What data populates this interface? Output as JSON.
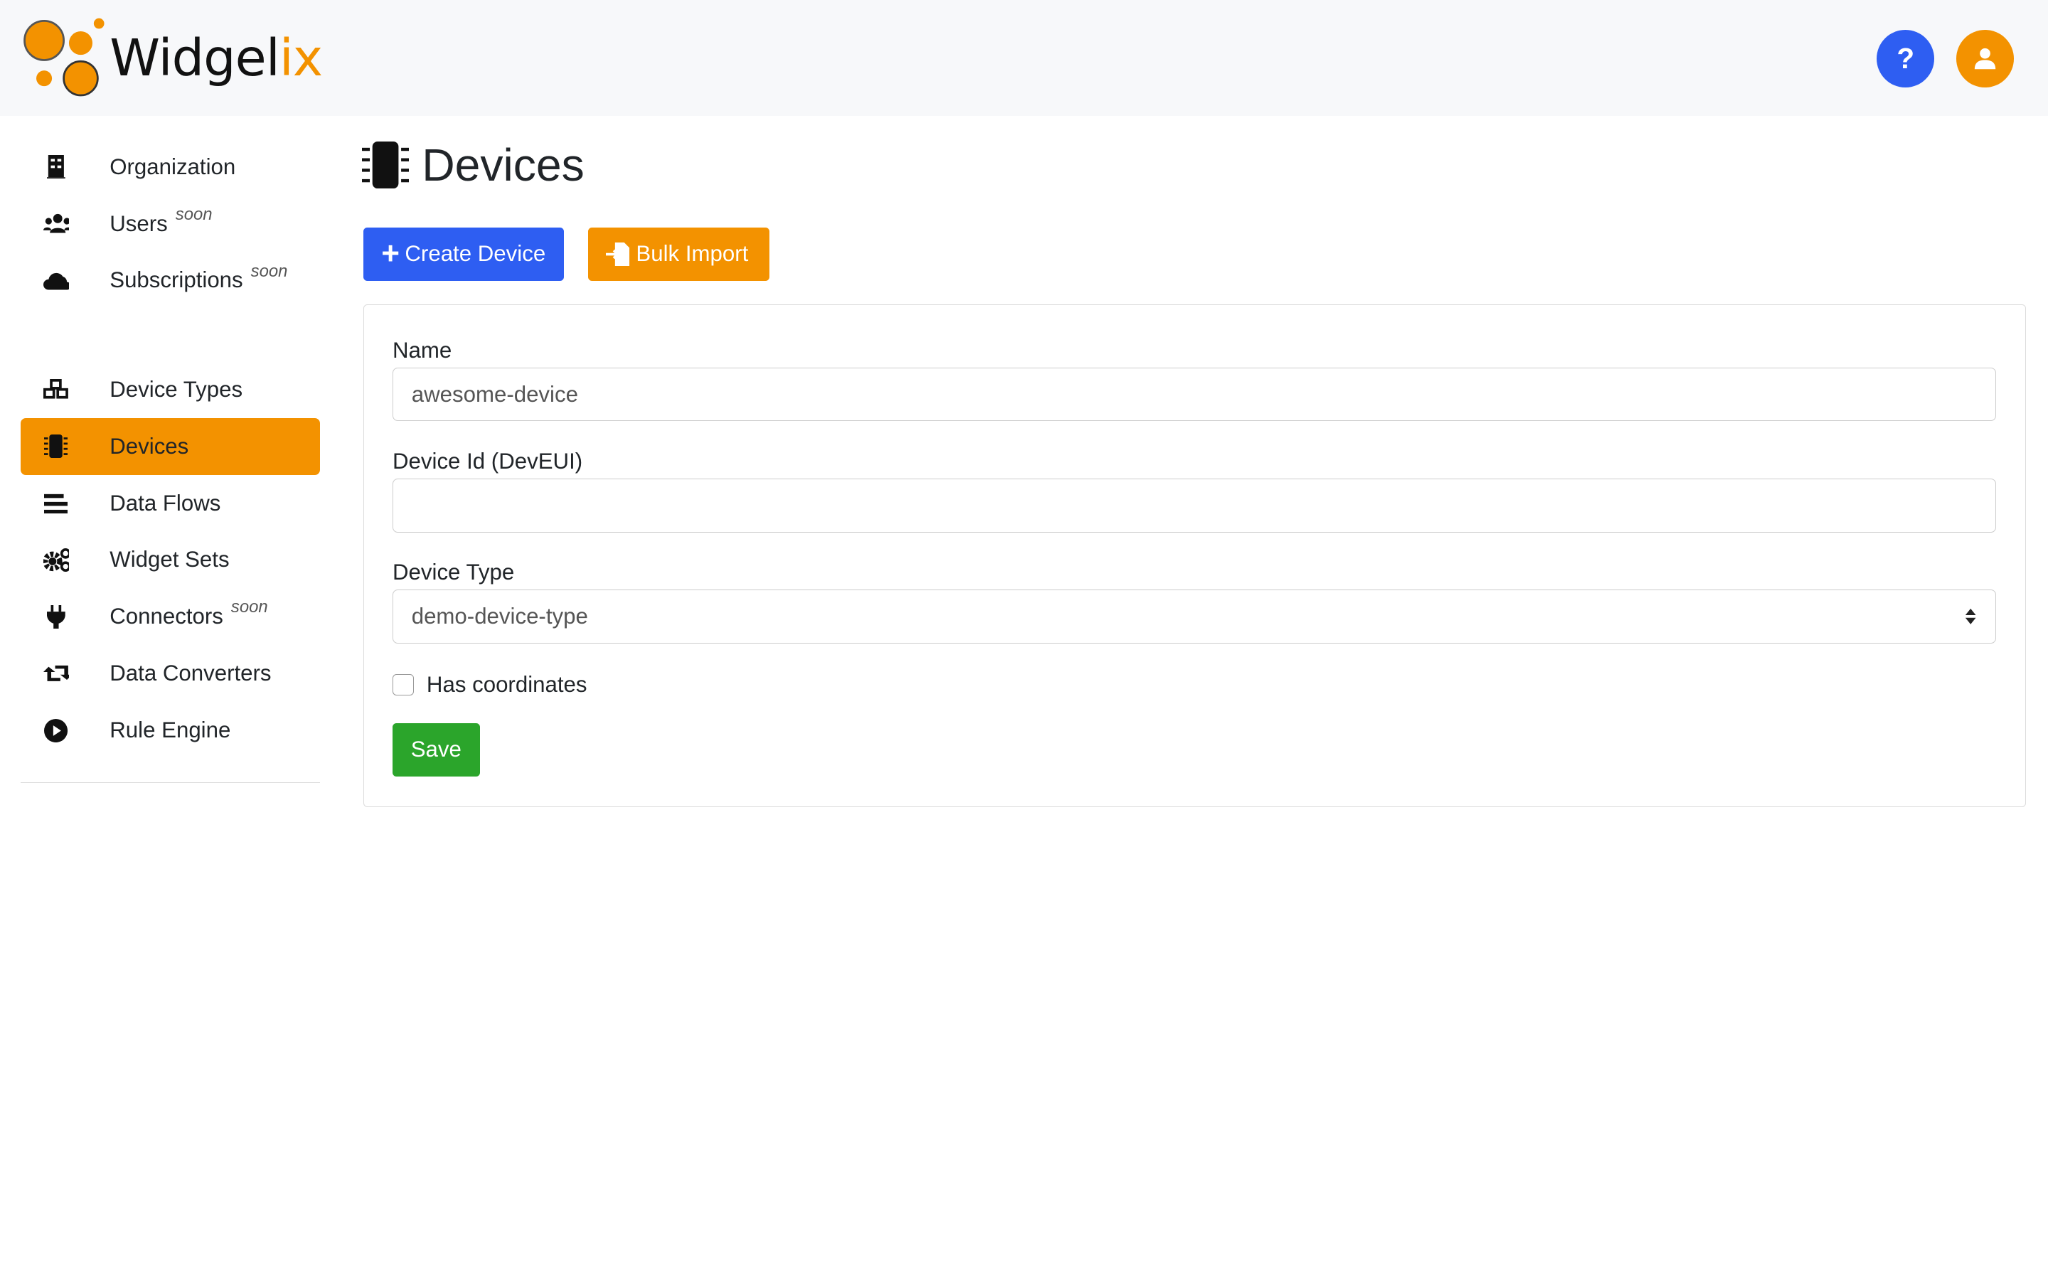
{
  "header": {
    "logo_text_main": "Widgel",
    "logo_text_accent": "ix",
    "help_label": "?"
  },
  "sidebar": {
    "items": [
      {
        "label": "Organization",
        "icon": "building-icon"
      },
      {
        "label": "Users",
        "icon": "users-icon",
        "badge": "soon"
      },
      {
        "label": "Subscriptions",
        "icon": "cloud-icon",
        "badge": "soon"
      },
      {
        "label": "Device Types",
        "icon": "cubes-icon"
      },
      {
        "label": "Devices",
        "icon": "microchip-icon",
        "active": true
      },
      {
        "label": "Data Flows",
        "icon": "bars-icon"
      },
      {
        "label": "Widget Sets",
        "icon": "cogs-icon"
      },
      {
        "label": "Connectors",
        "icon": "plug-icon",
        "badge": "soon"
      },
      {
        "label": "Data Converters",
        "icon": "retweet-icon"
      },
      {
        "label": "Rule Engine",
        "icon": "play-circle-icon"
      }
    ]
  },
  "main": {
    "title": "Devices",
    "create_label": "Create Device",
    "bulk_label": "Bulk Import",
    "form": {
      "name_label": "Name",
      "name_value": "awesome-device",
      "devid_label": "Device Id (DevEUI)",
      "devid_value": "",
      "type_label": "Device Type",
      "type_value": "demo-device-type",
      "coords_label": "Has coordinates",
      "coords_checked": false,
      "save_label": "Save"
    }
  },
  "colors": {
    "accent": "#f39200",
    "primary": "#2e5ef2",
    "success": "#2ba52b"
  }
}
